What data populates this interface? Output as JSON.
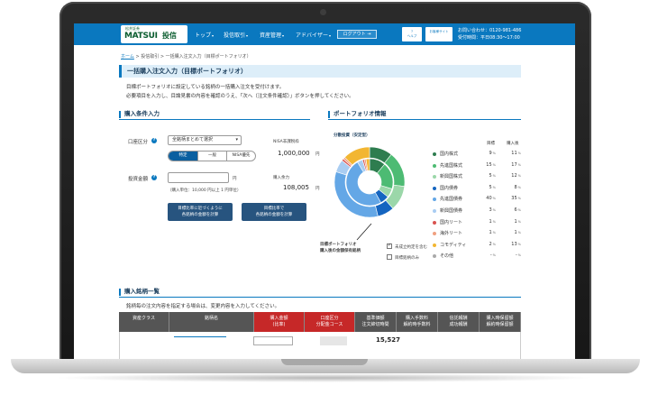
{
  "header": {
    "logo_sub": "松井証券",
    "logo_main": "MATSUI",
    "logo_jp": "投信",
    "nav": [
      {
        "label": "トップ",
        "x": 134
      },
      {
        "label": "投信取引",
        "x": 170
      },
      {
        "label": "資産管理",
        "x": 213
      },
      {
        "label": "アドバイザー",
        "x": 252
      }
    ],
    "logout_label": "ログアウト",
    "help_label": "ヘルプ",
    "site_label": "お客様サイト",
    "contact_phone": "お問い合わせ：0120-981-486",
    "contact_hours": "受付時間：平日08:30〜17:00"
  },
  "breadcrumb": {
    "home": "ホーム",
    "sep1": ">",
    "item1": "投信取引",
    "sep2": ">",
    "current": "一括購入注文入力（目標ポートフォリオ）"
  },
  "page_title": "一括購入注文入力（目標ポートフォリオ）",
  "description": {
    "line1": "目標ポートフォリオに設定している銘柄の一括購入注文を受付けます。",
    "line2": "必要項目を入力し、目論見書の内容を確認のうえ、「次へ（注文条件確認）」ボタンを押してください。"
  },
  "purchase_conditions": {
    "heading": "購入条件入力",
    "account_label": "口座区分",
    "select_value": "全銘柄まとめて選択",
    "segments": [
      "特定",
      "一般",
      "NISA優先"
    ],
    "amount_label": "投資金額",
    "amount_unit": "円",
    "amount_note": "（購入単位：10,000 円以上 1 円単位）",
    "nisa_label": "NISA非課税枠",
    "nisa_value": "1,000,000",
    "nisa_unit": "円",
    "power_label": "購入余力",
    "power_value": "108,005",
    "power_unit": "円",
    "calc_btn1_line1": "目標比率に近づくように",
    "calc_btn1_line2": "各銘柄の金額を計算",
    "calc_btn2_line1": "目標比率で",
    "calc_btn2_line2": "各銘柄の金額を計算"
  },
  "portfolio_info": {
    "heading": "ポートフォリオ情報",
    "chart_title": "分散投資（安定型）",
    "col_target": "目標",
    "col_after": "購入後",
    "callout_line1": "目標ポートフォリオ",
    "callout_line2": "購入後の金額保有銘柄",
    "checkbox1": "未成立約定を含む",
    "checkbox2": "目標銘柄のみ"
  },
  "chart_data": {
    "type": "pie",
    "title": "分散投資（安定型）",
    "series": [
      {
        "name": "目標",
        "values": [
          9,
          15,
          5,
          5,
          40,
          3,
          1,
          1,
          2,
          null
        ]
      },
      {
        "name": "購入後",
        "values": [
          11,
          17,
          12,
          8,
          35,
          6,
          1,
          1,
          13,
          null
        ]
      }
    ],
    "categories": [
      "国内株式",
      "先進国株式",
      "新興国株式",
      "国内債券",
      "先進国債券",
      "新興国債券",
      "国内リート",
      "海外リート",
      "コモディティ",
      "その他"
    ],
    "colors": [
      "#2e7d4f",
      "#4dbb73",
      "#9bd7a9",
      "#1565c0",
      "#64a7e6",
      "#a9cdf2",
      "#d9534f",
      "#f0a080",
      "#f2b632",
      "#aaaaaa"
    ],
    "unit": "%",
    "other_label": "-"
  },
  "purchase_list": {
    "heading": "購入銘柄一覧",
    "instruction": "銘柄毎の注文内容を指定する場合は、変更内容を入力してください。",
    "columns": [
      {
        "label1": "資産クラス",
        "label2": "",
        "bg": "#555555"
      },
      {
        "label1": "銘柄名",
        "label2": "",
        "bg": "#555555"
      },
      {
        "label1": "購入金額",
        "label2": "(比率)",
        "bg": "#c62828"
      },
      {
        "label1": "口座区分",
        "label2": "分配金コース",
        "bg": "#c62828"
      },
      {
        "label1": "基準価額",
        "label2": "注文締切時間",
        "bg": "#555555"
      },
      {
        "label1": "購入手数料",
        "label2": "解約時手数料",
        "bg": "#555555"
      },
      {
        "label1": "信託報酬",
        "label2": "成功報酬",
        "bg": "#555555"
      },
      {
        "label1": "購入時保留額",
        "label2": "解約時保留額",
        "bg": "#555555"
      }
    ],
    "first_row_price": "15,527"
  }
}
